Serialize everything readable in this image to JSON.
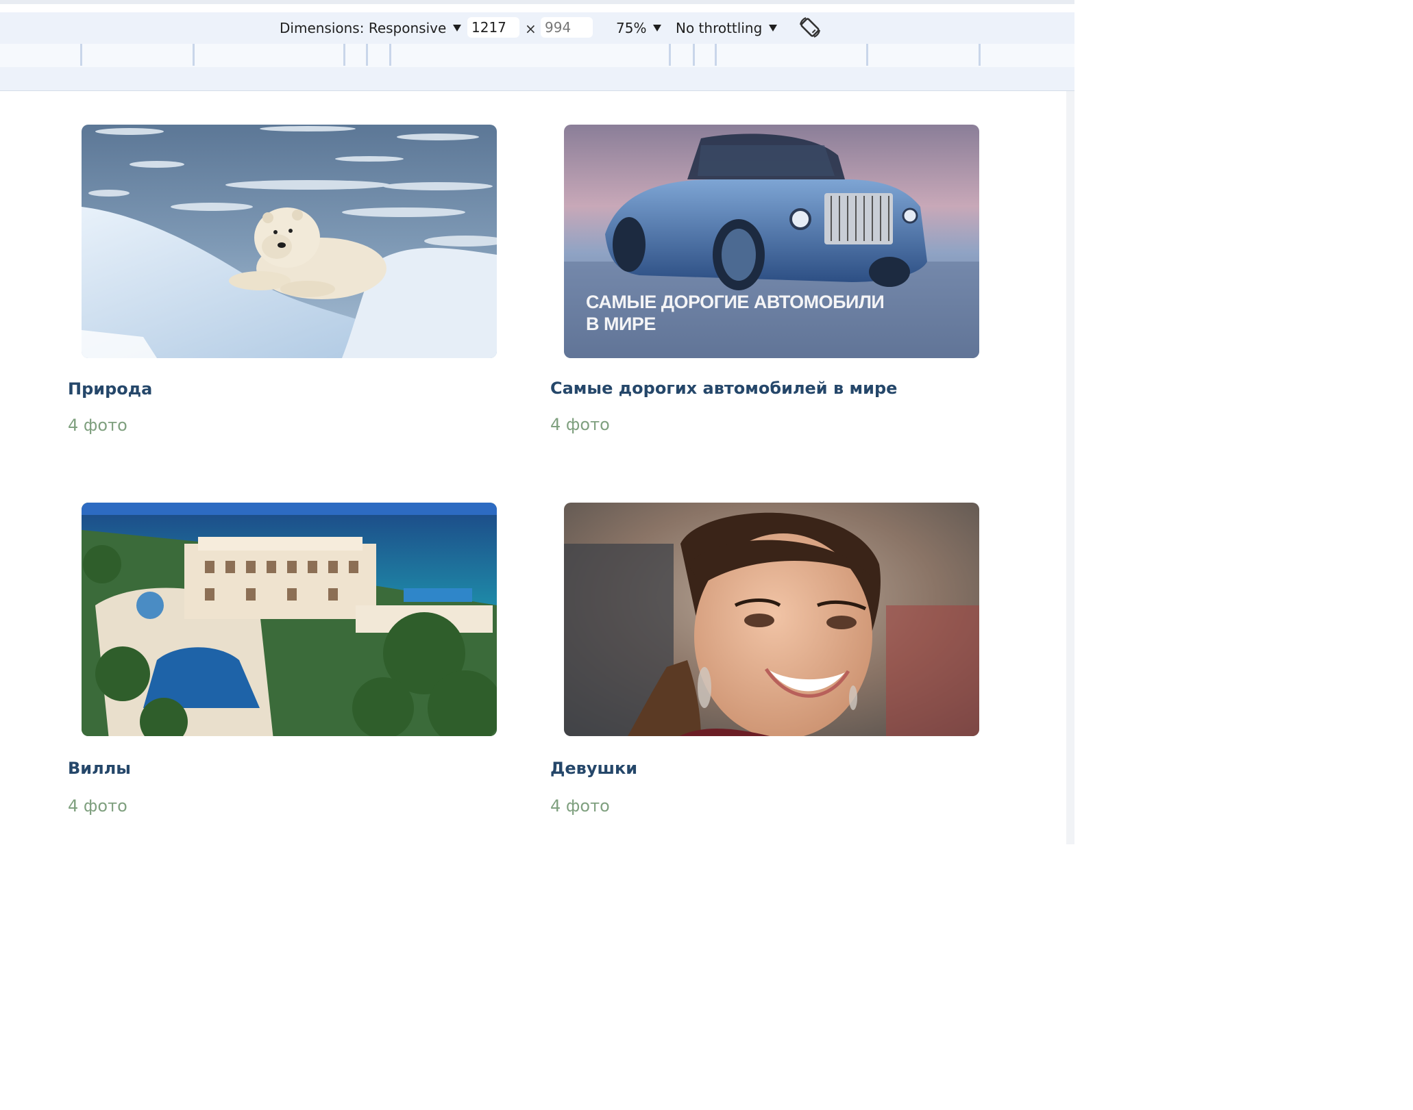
{
  "devtools": {
    "dimensions_label": "Dimensions: Responsive",
    "width_value": "1217",
    "height_placeholder": "994",
    "times": "×",
    "zoom_label": "75%",
    "throttling_label": "No throttling",
    "rotate_icon": "rotate-device-icon"
  },
  "albums": [
    {
      "title": "Природа",
      "count": "4 фото",
      "image": "polar-bear-on-ice"
    },
    {
      "title": "Самые дорогих автомобилей в мире",
      "count": "4 фото",
      "image": "blue-convertible-car",
      "overlay_line1": "САМЫЕ ДОРОГИЕ АВТОМОБИЛИ",
      "overlay_line2": "В МИРЕ"
    },
    {
      "title": "Виллы",
      "count": "4 фото",
      "image": "seaside-villa-aerial"
    },
    {
      "title": "Девушки",
      "count": "4 фото",
      "image": "smiling-woman-portrait"
    }
  ],
  "colors": {
    "title": "#25476a",
    "count": "#7fa07f",
    "toolbar_bg": "#edf2fa"
  }
}
